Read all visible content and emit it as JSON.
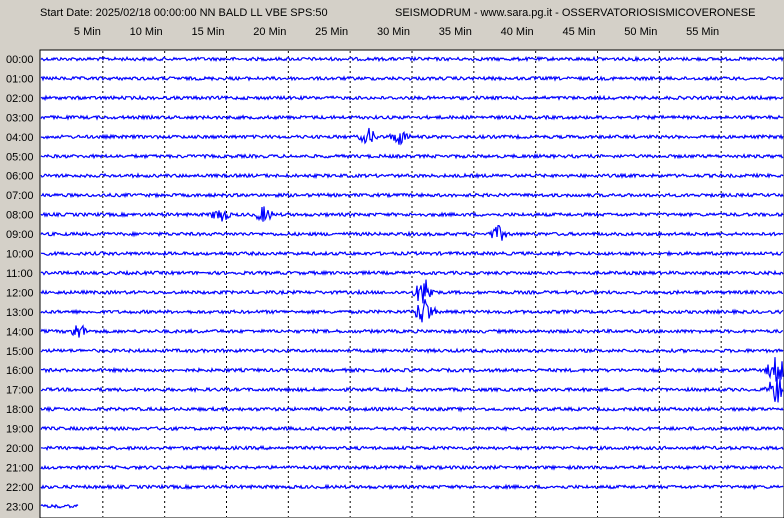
{
  "header": {
    "start_info": "Start Date: 2025/02/18 00:00:00 NN BALD LL VBE SPS:50",
    "source": "SEISMODRUM - www.sara.pg.it - OSSERVATORIOSISMICOVERONESE"
  },
  "chart_data": {
    "type": "line",
    "title": "",
    "x_tick_labels": [
      "5 Min",
      "10 Min",
      "15 Min",
      "20 Min",
      "25 Min",
      "30 Min",
      "35 Min",
      "40 Min",
      "45 Min",
      "50 Min",
      "55 Min"
    ],
    "x_ticks_min": [
      5,
      10,
      15,
      20,
      25,
      30,
      35,
      40,
      45,
      50,
      55
    ],
    "xlim": [
      0,
      60
    ],
    "x_unit": "Min",
    "row_labels": [
      "00:00",
      "01:00",
      "02:00",
      "03:00",
      "04:00",
      "05:00",
      "06:00",
      "07:00",
      "08:00",
      "09:00",
      "10:00",
      "11:00",
      "12:00",
      "13:00",
      "14:00",
      "15:00",
      "16:00",
      "17:00",
      "18:00",
      "19:00",
      "20:00",
      "21:00",
      "22:00",
      "23:00"
    ],
    "trace_color": "#0000ff",
    "grid_color": "#000000",
    "grid": "dashed vertical lines every 5 minutes",
    "last_trace_end_min": 3,
    "events": [
      {
        "row": "04:00",
        "minute": 26.5,
        "amplitude": "medium"
      },
      {
        "row": "04:00",
        "minute": 29.0,
        "amplitude": "medium"
      },
      {
        "row": "08:00",
        "minute": 14.5,
        "amplitude": "medium"
      },
      {
        "row": "08:00",
        "minute": 18.0,
        "amplitude": "medium"
      },
      {
        "row": "09:00",
        "minute": 37.0,
        "amplitude": "medium"
      },
      {
        "row": "12:00",
        "minute": 31.0,
        "amplitude": "large"
      },
      {
        "row": "13:00",
        "minute": 31.0,
        "amplitude": "large"
      },
      {
        "row": "14:00",
        "minute": 3.0,
        "amplitude": "medium"
      },
      {
        "row": "16:00",
        "minute": 59.5,
        "amplitude": "large"
      },
      {
        "row": "17:00",
        "minute": 59.5,
        "amplitude": "large"
      }
    ]
  }
}
